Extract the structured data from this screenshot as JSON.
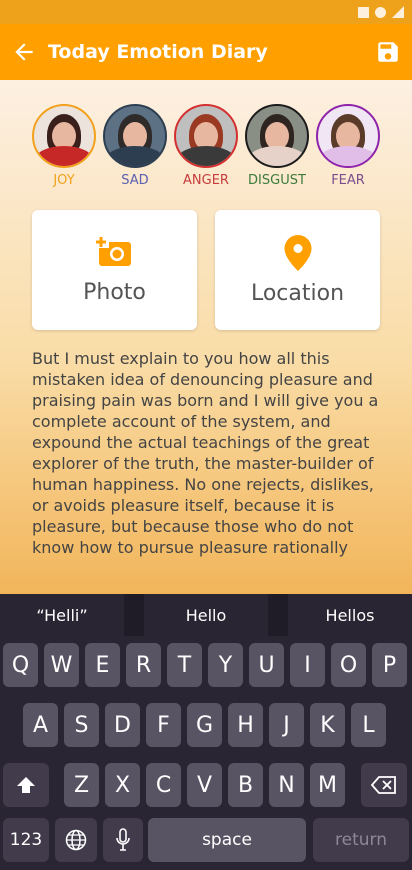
{
  "app": {
    "title": "Today Emotion Diary"
  },
  "emotions": [
    {
      "label": "JOY",
      "color": "#f2a11d",
      "hair": "#3b1f1a",
      "shirt": "#c62828",
      "border": "#f2a11d"
    },
    {
      "label": "SAD",
      "color": "#5a5fb0",
      "hair": "#2f2b2a",
      "shirt": "#2c3e50",
      "border": "#2c3e50"
    },
    {
      "label": "ANGER",
      "color": "#c73c3c",
      "hair": "#9b3a22",
      "shirt": "#3a3a3a",
      "border": "#d32f2f"
    },
    {
      "label": "DISGUST",
      "color": "#3b7a3b",
      "hair": "#2e2520",
      "shirt": "#e6d2c8",
      "border": "#1b1b1b"
    },
    {
      "label": "FEAR",
      "color": "#7c4d8e",
      "hair": "#5a3b2a",
      "shirt": "#e1bee7",
      "border": "#8e24aa"
    }
  ],
  "actions": {
    "photo_label": "Photo",
    "location_label": "Location",
    "accent": "#ffa000"
  },
  "diary_text": "But I must explain to you how all this mistaken idea of denouncing pleasure and praising pain was born and I will give you a complete account of the system, and expound the actual teachings of the great explorer of the truth, the master-builder of human happiness. No one rejects, dislikes, or avoids pleasure itself, because it is pleasure, but because those who do not know how to pursue pleasure rationally",
  "keyboard": {
    "suggestions": [
      "“Helli”",
      "Hello",
      "Hellos"
    ],
    "row1": [
      "Q",
      "W",
      "E",
      "R",
      "T",
      "Y",
      "U",
      "I",
      "O",
      "P"
    ],
    "row2": [
      "A",
      "S",
      "D",
      "F",
      "G",
      "H",
      "J",
      "K",
      "L"
    ],
    "row3": [
      "Z",
      "X",
      "C",
      "V",
      "B",
      "N",
      "M"
    ],
    "numbers_label": "123",
    "space_label": "space",
    "return_label": "return"
  }
}
